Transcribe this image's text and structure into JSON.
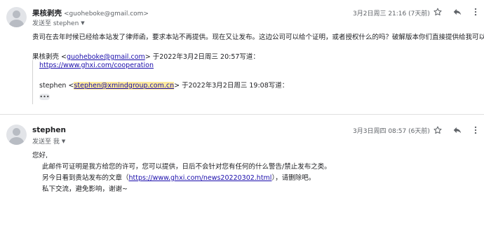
{
  "messages": [
    {
      "sender_name": "果核剥壳",
      "sender_email": "<guoheboke@gmail.com>",
      "to_line": "发送至 stephen",
      "date": "3月2日周三 21:16 (7天前)",
      "body": "贵司在去年时候已经给本站发了律师函，要求本站不再提供。现在又让发布。这边公司可以给个证明，或者授权什么的吗？破解版本你们直接提供给我可以？",
      "quote_header_name": "果核剥壳 <",
      "quote_header_email": "guoheboke@gmail.com",
      "quote_header_suffix": "> 于2022年3月2日周三 20:57写道：",
      "quote_link": "https://www.ghxi.com/cooperation",
      "nested_prefix": "stephen <",
      "nested_email": "stephen@xmindgroup.com.cn",
      "nested_suffix": "> 于2022年3月2日周三 19:08写道：",
      "more_label": "•••"
    },
    {
      "sender_name": "stephen",
      "to_line": "发送至 我",
      "date": "3月3日周四 08:57 (6天前)",
      "greeting": "您好,",
      "line1": "此邮件可证明是我方给您的许可，您可以提供，日后不会针对您有任何的什么警告/禁止发布之类。",
      "line2_prefix": "另今日看到贵站发布的文章（",
      "line2_link": "https://www.ghxi.com/news20220302.html",
      "line2_suffix": "），请删除吧。",
      "line3": "私下交流，避免影响，谢谢~"
    }
  ],
  "icons": {
    "star": "star-icon",
    "reply": "reply-icon",
    "more": "more-vert-icon",
    "caret": "caret-down-icon",
    "avatar": "avatar-icon"
  },
  "colors": {
    "link": "#1a0dab",
    "highlight": "#fce99b",
    "secondary_text": "#5f6368"
  }
}
